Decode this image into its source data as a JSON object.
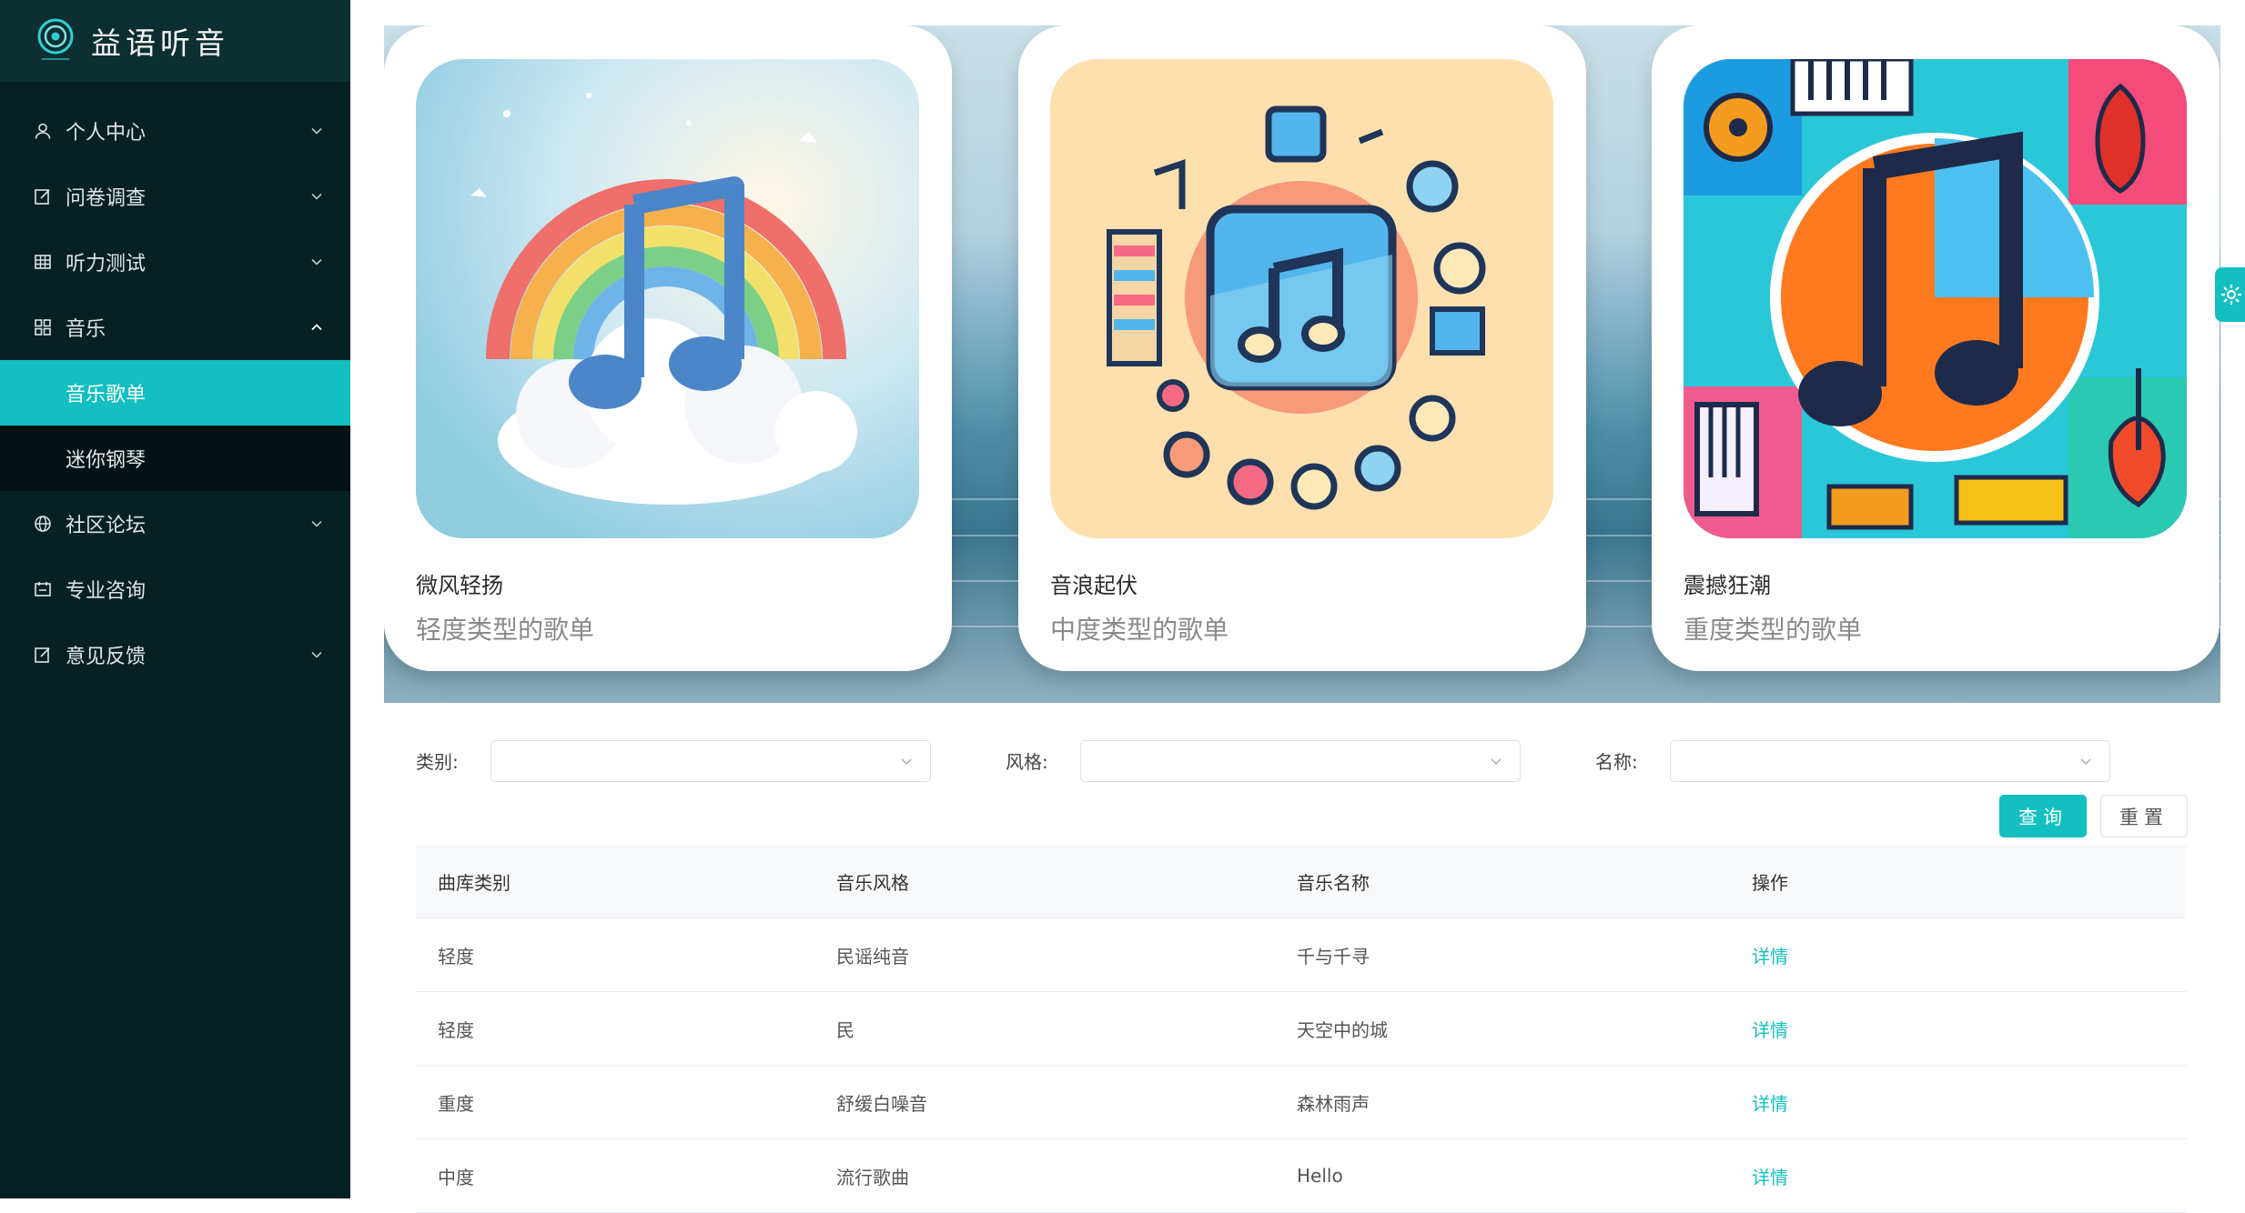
{
  "app": {
    "title": "益语听音"
  },
  "sidebar": {
    "menu": [
      {
        "label": "个人中心",
        "icon": "user-icon",
        "expandable": true
      },
      {
        "label": "问卷调查",
        "icon": "edit-icon",
        "expandable": true
      },
      {
        "label": "听力测试",
        "icon": "table-icon",
        "expandable": true
      },
      {
        "label": "音乐",
        "icon": "grid-icon",
        "expandable": true,
        "expanded": true,
        "children": [
          {
            "label": "音乐歌单",
            "active": true
          },
          {
            "label": "迷你钢琴",
            "active": false
          }
        ]
      },
      {
        "label": "社区论坛",
        "icon": "globe-icon",
        "expandable": true
      },
      {
        "label": "专业咨询",
        "icon": "calendar-icon",
        "expandable": false
      },
      {
        "label": "意见反馈",
        "icon": "edit-icon",
        "expandable": true
      }
    ]
  },
  "cards": [
    {
      "title": "微风轻扬",
      "subtitle": "轻度类型的歌单"
    },
    {
      "title": "音浪起伏",
      "subtitle": "中度类型的歌单"
    },
    {
      "title": "震撼狂潮",
      "subtitle": "重度类型的歌单"
    }
  ],
  "filters": {
    "category_label": "类别:",
    "style_label": "风格:",
    "name_label": "名称:",
    "category_value": "",
    "style_value": "",
    "name_value": "",
    "query_button": "查询",
    "reset_button": "重置"
  },
  "table": {
    "columns": [
      "曲库类别",
      "音乐风格",
      "音乐名称",
      "操作"
    ],
    "rows": [
      {
        "category": "轻度",
        "style": "民谣纯音",
        "name": "千与千寻",
        "action": "详情"
      },
      {
        "category": "轻度",
        "style": "民",
        "name": "天空中的城",
        "action": "详情"
      },
      {
        "category": "重度",
        "style": "舒缓白噪音",
        "name": "森林雨声",
        "action": "详情"
      },
      {
        "category": "中度",
        "style": "流行歌曲",
        "name": "Hello",
        "action": "详情"
      }
    ]
  },
  "colors": {
    "accent": "#13bfc0",
    "sidebar_bg": "#072022",
    "logo_bar_bg": "#0d2f32"
  }
}
